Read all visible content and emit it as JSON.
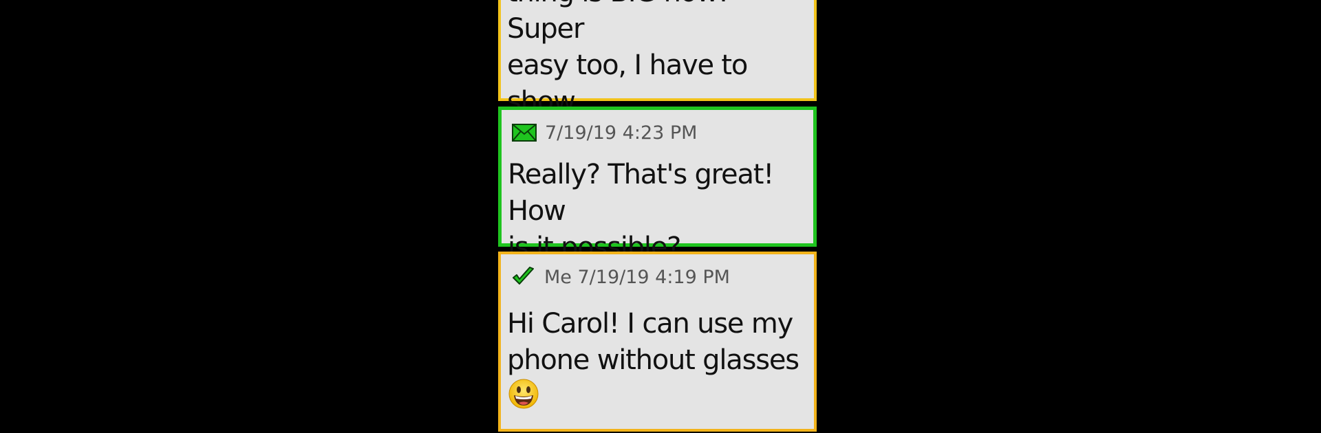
{
  "thread": {
    "messages": [
      {
        "id": "message-partial",
        "text": "thing is BIG now! Super\neasy too, I have to show\nyou next time we meet.",
        "border_color": "#f2c31b"
      },
      {
        "id": "message-incoming",
        "icon": "envelope-icon",
        "timestamp": "7/19/19 4:23 PM",
        "text": "Really? That's great! How\nis it possible?",
        "border_color": "#1fc41f"
      },
      {
        "id": "message-outgoing",
        "icon": "checkmark-icon",
        "timestamp": "Me 7/19/19 4:19 PM",
        "text": "Hi Carol! I can use my\nphone without glasses",
        "emoji": "grinning-face-emoji",
        "border_color": "#f2b31b"
      }
    ]
  },
  "colors": {
    "background": "#000000",
    "bubble_fill": "#e4e4e4",
    "accent_green": "#1fc41f",
    "accent_yellow": "#f2c31b"
  }
}
